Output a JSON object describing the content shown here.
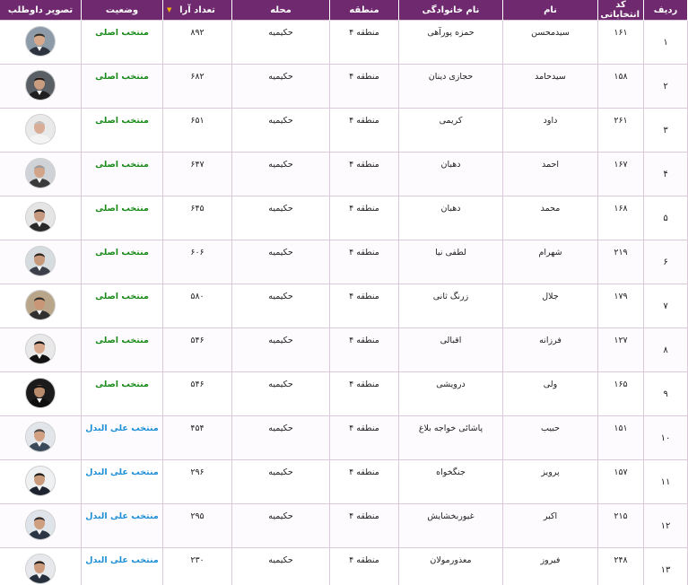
{
  "colors": {
    "header_bg": "#6f2a6f",
    "main_status": "#1a8a1a",
    "alternate_status": "#1e8fd6",
    "sort_indicator": "#f5b400"
  },
  "headers": {
    "row": "ردیف",
    "code": "کد انتخاباتی",
    "first_name": "نام",
    "family_name": "نام خانوادگی",
    "region": "منطقه",
    "district": "محله",
    "votes": "تعداد آرا",
    "status": "وضعیت",
    "photo": "تصویر داوطلب"
  },
  "sorted_column": "votes",
  "sort_icon": "sort-desc-icon",
  "candidates": [
    {
      "row": "۱",
      "code": "۱۶۱",
      "first_name": "سیدمحسن",
      "family_name": "حمزه پورآهی",
      "region": "منطقه ۴",
      "district": "حکیمیه",
      "votes": "۸۹۲",
      "status": "منتخب اصلی",
      "status_type": "main",
      "photo_bg": "#8d9aa8",
      "suit": "#2d3440",
      "hair": "#2b2b2b",
      "skin": "#d7a98a"
    },
    {
      "row": "۲",
      "code": "۱۵۸",
      "first_name": "سیدحامد",
      "family_name": "حجازی دینان",
      "region": "منطقه ۴",
      "district": "حکیمیه",
      "votes": "۶۸۲",
      "status": "منتخب اصلی",
      "status_type": "main",
      "photo_bg": "#5a5f66",
      "suit": "#1f1f1f",
      "hair": "#151515",
      "skin": "#c99c80"
    },
    {
      "row": "۳",
      "code": "۲۶۱",
      "first_name": "داود",
      "family_name": "کریمی",
      "region": "منطقه ۴",
      "district": "حکیمیه",
      "votes": "۶۵۱",
      "status": "منتخب اصلی",
      "status_type": "main",
      "photo_bg": "#e9e9e9",
      "suit": "#f4f4f4",
      "hair": "#bdbdbd",
      "skin": "#d9ad95"
    },
    {
      "row": "۴",
      "code": "۱۶۷",
      "first_name": "احمد",
      "family_name": "دهبان",
      "region": "منطقه ۴",
      "district": "حکیمیه",
      "votes": "۶۴۷",
      "status": "منتخب اصلی",
      "status_type": "main",
      "photo_bg": "#cfd2d6",
      "suit": "#3a3a3a",
      "hair": "#9a9a9a",
      "skin": "#d2a58a"
    },
    {
      "row": "۵",
      "code": "۱۶۸",
      "first_name": "محمد",
      "family_name": "دهبان",
      "region": "منطقه ۴",
      "district": "حکیمیه",
      "votes": "۶۴۵",
      "status": "منتخب اصلی",
      "status_type": "main",
      "photo_bg": "#e5e5e5",
      "suit": "#2a2a2a",
      "hair": "#1c1c1c",
      "skin": "#c69a7e"
    },
    {
      "row": "۶",
      "code": "۲۱۹",
      "first_name": "شهرام",
      "family_name": "لطفی نیا",
      "region": "منطقه ۴",
      "district": "حکیمیه",
      "votes": "۶۰۶",
      "status": "منتخب اصلی",
      "status_type": "main",
      "photo_bg": "#d6dbe0",
      "suit": "#3c3f4a",
      "hair": "#2a2420",
      "skin": "#c8987a"
    },
    {
      "row": "۷",
      "code": "۱۷۹",
      "first_name": "جلال",
      "family_name": "زرنگ ثانی",
      "region": "منطقه ۴",
      "district": "حکیمیه",
      "votes": "۵۸۰",
      "status": "منتخب اصلی",
      "status_type": "main",
      "photo_bg": "#b8a58a",
      "suit": "#2f2f2f",
      "hair": "#2a2a2a",
      "skin": "#c99676"
    },
    {
      "row": "۸",
      "code": "۱۲۷",
      "first_name": "فرزانه",
      "family_name": "اقبالی",
      "region": "منطقه ۴",
      "district": "حکیمیه",
      "votes": "۵۴۶",
      "status": "منتخب اصلی",
      "status_type": "main",
      "photo_bg": "#e8e8e8",
      "suit": "#111111",
      "hair": "#111111",
      "skin": "#d8a88c"
    },
    {
      "row": "۹",
      "code": "۱۶۵",
      "first_name": "ولی",
      "family_name": "درویشی",
      "region": "منطقه ۴",
      "district": "حکیمیه",
      "votes": "۵۴۶",
      "status": "منتخب اصلی",
      "status_type": "main",
      "photo_bg": "#1b1b1b",
      "suit": "#0e0e0e",
      "hair": "#111111",
      "skin": "#b98a6c"
    },
    {
      "row": "۱۰",
      "code": "۱۵۱",
      "first_name": "حبیب",
      "family_name": "پاشائی خواجه بلاغ",
      "region": "منطقه ۴",
      "district": "حکیمیه",
      "votes": "۴۵۴",
      "status": "منتخب علی البدل",
      "status_type": "alternate",
      "photo_bg": "#e2e6ea",
      "suit": "#3a4a5a",
      "hair": "#4a4a4a",
      "skin": "#d2a184"
    },
    {
      "row": "۱۱",
      "code": "۱۵۷",
      "first_name": "پرویز",
      "family_name": "جنگخواه",
      "region": "منطقه ۴",
      "district": "حکیمیه",
      "votes": "۲۹۶",
      "status": "منتخب علی البدل",
      "status_type": "alternate",
      "photo_bg": "#eef0f2",
      "suit": "#1d2430",
      "hair": "#1a1a1a",
      "skin": "#c99a7c"
    },
    {
      "row": "۱۲",
      "code": "۲۱۵",
      "first_name": "اکبر",
      "family_name": "غیوربخشایش",
      "region": "منطقه ۴",
      "district": "حکیمیه",
      "votes": "۲۹۵",
      "status": "منتخب علی البدل",
      "status_type": "alternate",
      "photo_bg": "#dfe4ea",
      "suit": "#2b3544",
      "hair": "#2b2b2b",
      "skin": "#cf9f82"
    },
    {
      "row": "۱۳",
      "code": "۲۴۸",
      "first_name": "فیروز",
      "family_name": "معذورمولان",
      "region": "منطقه ۴",
      "district": "حکیمیه",
      "votes": "۲۳۰",
      "status": "منتخب علی البدل",
      "status_type": "alternate",
      "photo_bg": "#e6e8eb",
      "suit": "#26303c",
      "hair": "#1e1e1e",
      "skin": "#cc9b7d"
    }
  ]
}
